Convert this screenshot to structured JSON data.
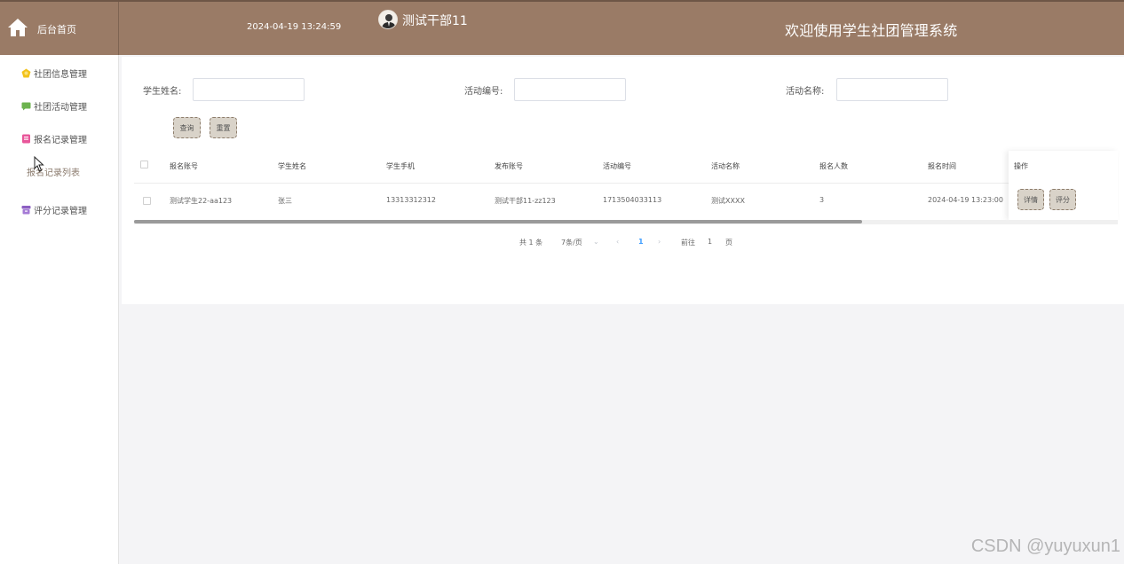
{
  "header": {
    "home_label": "后台首页",
    "datetime": "2024-04-19 13:24:59",
    "user_name": "测试干部11",
    "welcome": "欢迎使用学生社团管理系统",
    "bg_color": "#9a7b66"
  },
  "sidebar": {
    "items": [
      {
        "label": "社团信息管理",
        "icon": "yellow-gem-icon"
      },
      {
        "label": "社团活动管理",
        "icon": "green-chat-icon"
      },
      {
        "label": "报名记录管理",
        "icon": "pink-document-icon"
      },
      {
        "label": "评分记录管理",
        "icon": "purple-archive-icon"
      }
    ],
    "sub_item": "报名记录列表"
  },
  "search": {
    "student_name_label": "学生姓名:",
    "activity_no_label": "活动编号:",
    "activity_name_label": "活动名称:",
    "student_name_value": "",
    "activity_no_value": "",
    "activity_name_value": "",
    "query_button": "查询",
    "reset_button": "重置"
  },
  "table": {
    "columns": [
      "报名账号",
      "学生姓名",
      "学生手机",
      "发布账号",
      "活动编号",
      "活动名称",
      "报名人数",
      "报名时间",
      "操作"
    ],
    "rows": [
      {
        "account": "测试学生22-aa123",
        "name": "张三",
        "phone": "13313312312",
        "publisher": "测试干部11-zz123",
        "activity_no": "1713504033113",
        "activity_name": "测试XXXX",
        "count": "3",
        "time": "2024-04-19 13:23:00",
        "detail_button": "详情",
        "score_button": "评分"
      }
    ]
  },
  "pagination": {
    "total": "共 1 条",
    "page_size": "7条/页",
    "current_page": "1",
    "goto_prefix": "前往",
    "goto_value": "1",
    "goto_suffix": "页"
  },
  "watermark": "CSDN @yuyuxun1"
}
